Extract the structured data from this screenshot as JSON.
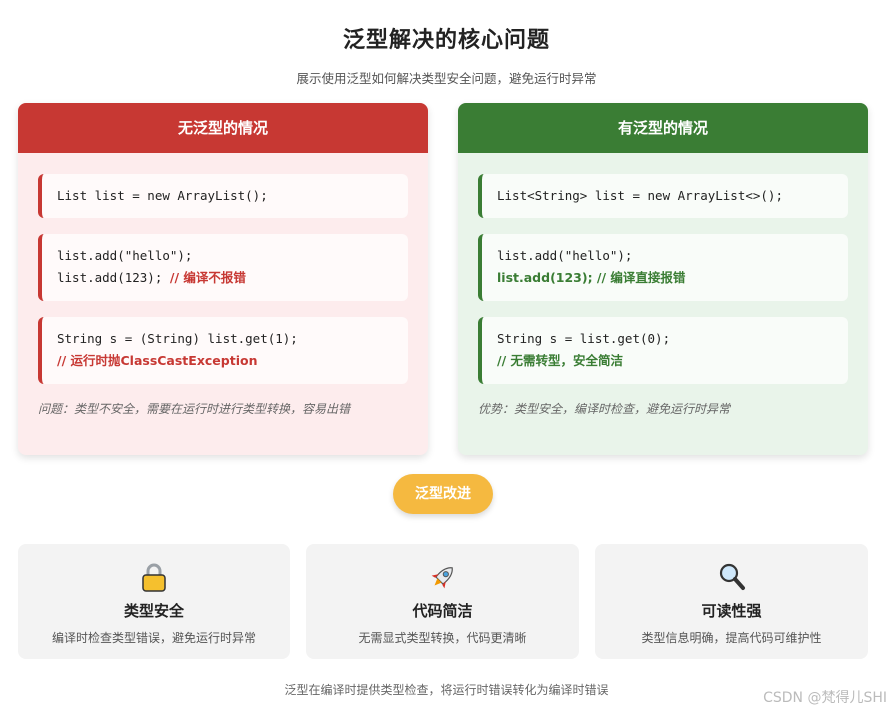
{
  "header": {
    "title": "泛型解决的核心问题",
    "subtitle": "展示使用泛型如何解决类型安全问题，避免运行时异常"
  },
  "panel_without": {
    "heading": "无泛型的情况",
    "code1": {
      "line1": "List list = new ArrayList();"
    },
    "code2": {
      "line1": "list.add(\"hello\");",
      "line2_code": "list.add(123); ",
      "line2_comment": "// 编译不报错"
    },
    "code3": {
      "line1": "String s = (String) list.get(1);",
      "line2_comment": "// 运行时抛ClassCastException"
    },
    "note": "问题：类型不安全，需要在运行时进行类型转换，容易出错",
    "color": "#c73833"
  },
  "panel_with": {
    "heading": "有泛型的情况",
    "code1": {
      "line1": "List<String> list = new ArrayList<>();"
    },
    "code2": {
      "line1": "list.add(\"hello\");",
      "line2_comment": "list.add(123); // 编译直接报错"
    },
    "code3": {
      "line1": "String s = list.get(0);",
      "line2_comment": "// 无需转型，安全简洁"
    },
    "note": "优势：类型安全，编译时检查，避免运行时异常",
    "color": "#3a7d34"
  },
  "improve_pill": "泛型改进",
  "features": [
    {
      "icon": "lock-icon",
      "title": "类型安全",
      "desc": "编译时检查类型错误，避免运行时异常"
    },
    {
      "icon": "rocket-icon",
      "title": "代码简洁",
      "desc": "无需显式类型转换，代码更清晰"
    },
    {
      "icon": "magnifier-icon",
      "title": "可读性强",
      "desc": "类型信息明确，提高代码可维护性"
    }
  ],
  "footer": "泛型在编译时提供类型检查，将运行时错误转化为编译时错误",
  "watermark": "CSDN @梵得儿SHI"
}
